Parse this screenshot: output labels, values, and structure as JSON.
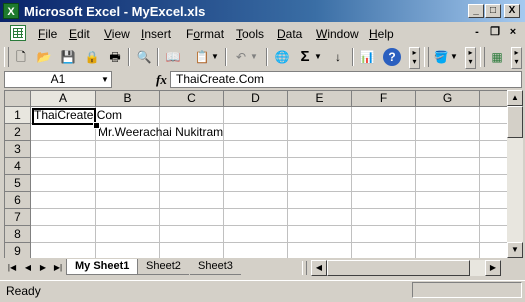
{
  "window": {
    "title": "Microsoft Excel - MyExcel.xls",
    "app_icon_glyph": "X"
  },
  "caption_buttons": {
    "minimize": "_",
    "restore": "□",
    "close": "X"
  },
  "menu": [
    "File",
    "Edit",
    "View",
    "Insert",
    "Format",
    "Tools",
    "Data",
    "Window",
    "Help"
  ],
  "menu_accel": [
    "F",
    "E",
    "V",
    "I",
    "o",
    "T",
    "D",
    "W",
    "H"
  ],
  "doc_buttons": {
    "minimize": "-",
    "restore": "❐",
    "close": "×"
  },
  "toolbar": {
    "icons": [
      "new-icon",
      "open-icon",
      "save-icon",
      "permission-icon",
      "print-icon",
      "print-preview-icon",
      "research-icon",
      "paste-icon",
      "undo-icon",
      "hyperlink-icon",
      "autosum-icon",
      "sort-ascending-icon",
      "chart-wizard-icon",
      "help-icon",
      "fill-color-icon",
      "drawing-icon"
    ],
    "glyphs": {
      "new": "🗋",
      "open": "📂",
      "save": "💾",
      "permission": "🔒",
      "print": "🖶",
      "preview": "🔍",
      "research": "📖",
      "paste": "📋",
      "undo": "↶",
      "hyperlink": "🌐",
      "autosum": "Σ",
      "sort": "↓",
      "chart": "📊",
      "help": "?",
      "fill": "🪣",
      "drawing": "▦"
    }
  },
  "formula_bar": {
    "name_box": "A1",
    "fx": "fx",
    "content": "ThaiCreate.Com"
  },
  "grid": {
    "columns": [
      "A",
      "B",
      "C",
      "D",
      "E",
      "F",
      "G"
    ],
    "rows": [
      "1",
      "2",
      "3",
      "4",
      "5",
      "6",
      "7",
      "8",
      "9"
    ],
    "active_cell": "A1",
    "cells": {
      "A1": "ThaiCreate.Com",
      "B2": "Mr.Weerachai Nukitram"
    }
  },
  "sheet_tabs": [
    "My Sheet1",
    "Sheet2",
    "Sheet3"
  ],
  "active_tab": "My Sheet1",
  "status": {
    "text": "Ready"
  },
  "colors": {
    "title_start": "#0a246a",
    "title_end": "#a6caf0",
    "face": "#d4d0c8"
  }
}
